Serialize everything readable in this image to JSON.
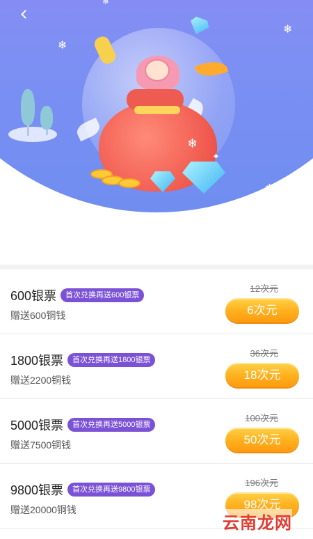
{
  "header": {
    "back_icon": "chevron-left-icon"
  },
  "items": [
    {
      "title": "600银票",
      "badge": "首次兑换再送600银票",
      "bonus": "赠送600铜钱",
      "original_price": "12次元",
      "price": "6次元"
    },
    {
      "title": "1800银票",
      "badge": "首次兑换再送1800银票",
      "bonus": "赠送2200铜钱",
      "original_price": "36次元",
      "price": "18次元"
    },
    {
      "title": "5000银票",
      "badge": "首次兑换再送5000银票",
      "bonus": "赠送7500铜钱",
      "original_price": "100次元",
      "price": "50次元"
    },
    {
      "title": "9800银票",
      "badge": "首次兑换再送9800银票",
      "bonus": "赠送20000铜钱",
      "original_price": "196次元",
      "price": "98次元"
    }
  ],
  "watermark": "云南龙网",
  "colors": {
    "banner_gradient_top": "#b67cf0",
    "banner_gradient_bottom": "#6f8ef0",
    "badge": "#7b52d6",
    "price_button": "#ffb21f"
  }
}
